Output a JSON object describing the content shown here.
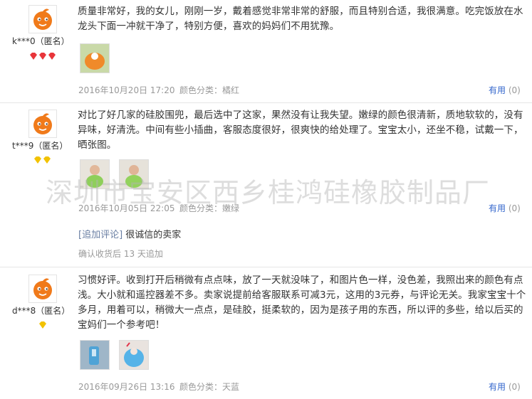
{
  "reviews": [
    {
      "nick": "k***0（匿名）",
      "content": "质量非常好，我的女儿，刚刚一岁，戴着感觉非常非常的舒服，而且特别合适，我很满意。吃完饭放在水龙头下面一冲就干净了，特别方便，喜欢的妈妈们不用犹豫。",
      "date": "2016年10月20日 17:20",
      "color": "颜色分类：橘红",
      "useful_label": "有用",
      "useful_count": "(0)"
    },
    {
      "nick": "t***9（匿名）",
      "content": "对比了好几家的硅胶围兜，最后选中了这家，果然没有让我失望。嫩绿的颜色很清新，质地软软的，没有异味，好清洗。中间有些小插曲，客服态度很好，很爽快的给处理了。宝宝太小，还坐不稳，试戴一下，晒张图。",
      "date": "2016年10月05日 22:05",
      "color": "颜色分类：嫩绿",
      "useful_label": "有用",
      "useful_count": "(0)",
      "additional_tag": "[追加评论]",
      "additional_text": "很诚信的卖家",
      "confirm": "确认收货后 13 天追加"
    },
    {
      "nick": "d***8（匿名）",
      "content": "习惯好评。收到打开后稍微有点点味，放了一天就没味了，和图片色一样，没色差，我照出来的颜色有点浅。大小就和遥控器差不多。卖家说提前给客服联系可减3元，这用的3元券，与评论无关。我家宝宝十个多月，用着可以，稍微大一点点，是硅胶，挺柔软的，因为是孩子用的东西，所以评的多些，给以后买的宝妈们一个参考吧！",
      "date": "2016年09月26日 13:16",
      "color": "颜色分类：天蓝",
      "useful_label": "有用",
      "useful_count": "(0)"
    }
  ],
  "watermark": "深圳市宝安区西乡桂鸿硅橡胶制品厂",
  "colors": {
    "link": "#3366cc",
    "meta": "#999999",
    "avatar_orange": "#f07a1a",
    "diamond_red": "#e8353a",
    "diamond_yellow": "#f2c200"
  }
}
